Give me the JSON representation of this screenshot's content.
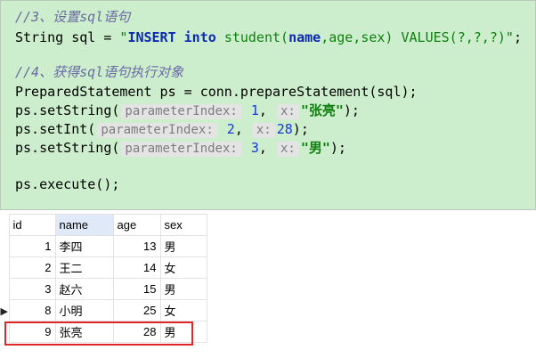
{
  "code": {
    "comment1": "//3、设置sql语句",
    "sql": {
      "p1": "String sql = ",
      "q1": "\"",
      "kw_insert": "INSERT",
      "kw_into": "into",
      "p2": "student(",
      "kw_name": "name",
      "p3": ",age,sex) VALUES(?,?,?)",
      "q2": "\"",
      "p4": ";"
    },
    "comment2": "//4、获得sql语句执行对象",
    "prepare": "PreparedStatement ps = conn.prepareStatement(sql);",
    "call1": {
      "method": "ps.setString(",
      "hint_index": "parameterIndex:",
      "index": "1",
      "sep": ",",
      "hint_x": "x:",
      "value": "\"张亮\"",
      "end": ");"
    },
    "call2": {
      "method": "ps.setInt(",
      "hint_index": "parameterIndex:",
      "index": "2",
      "sep": ",",
      "hint_x": "x:",
      "value": "28",
      "end": ");"
    },
    "call3": {
      "method": "ps.setString(",
      "hint_index": "parameterIndex:",
      "index": "3",
      "sep": ",",
      "hint_x": "x:",
      "value": "\"男\"",
      "end": ");"
    },
    "execute": "ps.execute();"
  },
  "table": {
    "columns": [
      "id",
      "name",
      "age",
      "sex"
    ],
    "selected_column": "name",
    "rows": [
      {
        "id": "1",
        "name": "李四",
        "age": "13",
        "sex": "男",
        "current": false
      },
      {
        "id": "2",
        "name": "王二",
        "age": "14",
        "sex": "女",
        "current": false
      },
      {
        "id": "3",
        "name": "赵六",
        "age": "15",
        "sex": "男",
        "current": false
      },
      {
        "id": "8",
        "name": "小明",
        "age": "25",
        "sex": "女",
        "current": true
      },
      {
        "id": "9",
        "name": "张亮",
        "age": "28",
        "sex": "男",
        "current": false
      }
    ],
    "current_row_marker": "▶",
    "highlighted_row": 4,
    "highlight_color": "#e0282a"
  },
  "colors": {
    "editor_background": "#cdeecd",
    "comment": "#6a6aa3",
    "keyword": "#0b2bb0",
    "string": "#0f7f0f",
    "number": "#1738d6",
    "hint_background": "#e4e4e4"
  }
}
